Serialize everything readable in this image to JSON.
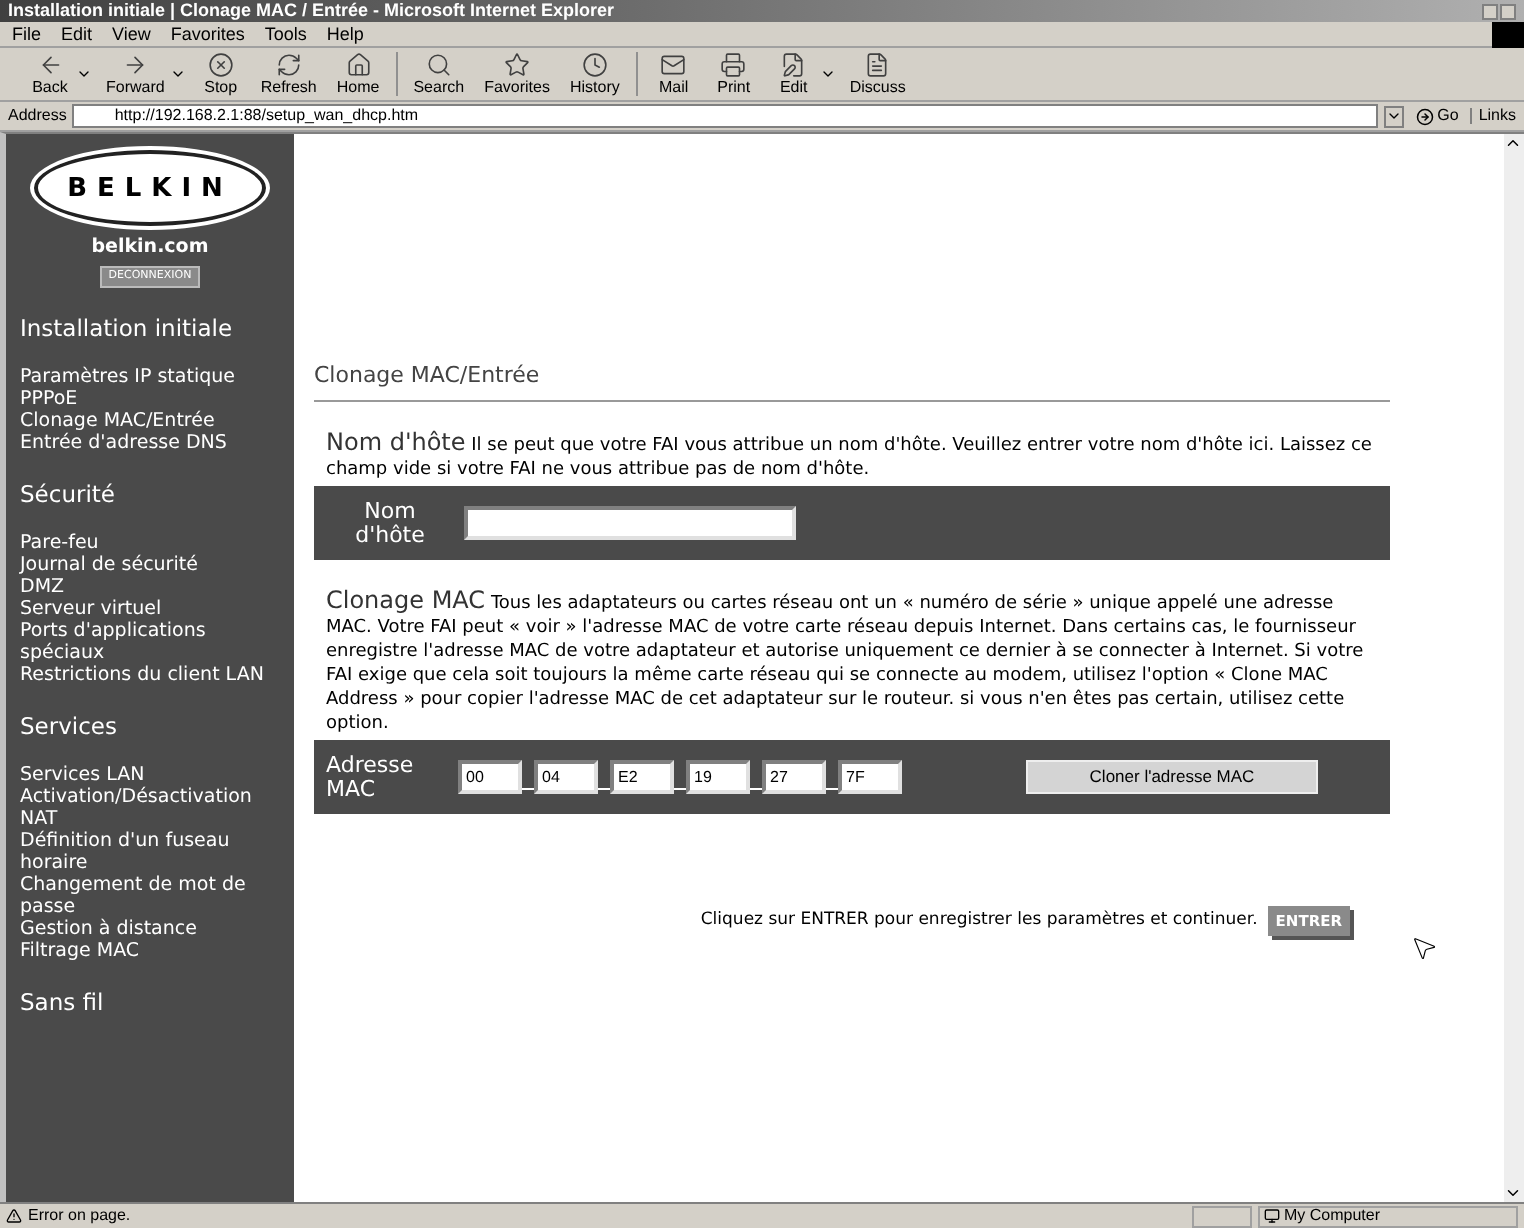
{
  "window": {
    "title": "Installation initiale | Clonage MAC / Entrée - Microsoft Internet Explorer"
  },
  "menu": [
    "File",
    "Edit",
    "View",
    "Favorites",
    "Tools",
    "Help"
  ],
  "toolbar": [
    {
      "label": "Back",
      "dropdown": true
    },
    {
      "label": "Forward",
      "dropdown": true
    },
    {
      "label": "Stop",
      "dropdown": false
    },
    {
      "label": "Refresh",
      "dropdown": false
    },
    {
      "label": "Home",
      "dropdown": false
    },
    {
      "label": "Search",
      "dropdown": false
    },
    {
      "label": "Favorites",
      "dropdown": false
    },
    {
      "label": "History",
      "dropdown": false
    },
    {
      "label": "Mail",
      "dropdown": false
    },
    {
      "label": "Print",
      "dropdown": false
    },
    {
      "label": "Edit",
      "dropdown": true
    },
    {
      "label": "Discuss",
      "dropdown": false
    }
  ],
  "address": {
    "label": "Address",
    "value": "http://192.168.2.1:88/setup_wan_dhcp.htm",
    "go": "Go",
    "links": "Links"
  },
  "sidebar": {
    "logo": "BELKIN",
    "site": "belkin.com",
    "logout": "DECONNEXION",
    "sections": [
      {
        "title": "Installation initiale",
        "items": [
          "Paramètres IP statique",
          "PPPoE",
          "Clonage MAC/Entrée",
          "Entrée d'adresse DNS"
        ]
      },
      {
        "title": "Sécurité",
        "items": [
          "Pare-feu",
          "Journal de sécurité",
          "DMZ",
          "Serveur virtuel",
          "Ports d'applications spéciaux",
          "Restrictions du client LAN"
        ]
      },
      {
        "title": "Services",
        "items": [
          "Services LAN",
          "Activation/Désactivation NAT",
          "Définition d'un fuseau horaire",
          "Changement de mot de passe",
          "Gestion à distance",
          "Filtrage MAC"
        ]
      },
      {
        "title": "Sans fil"
      }
    ]
  },
  "content": {
    "title": "Clonage MAC/Entrée",
    "hostname": {
      "heading": "Nom d'hôte",
      "text": "Il se peut que votre FAI vous attribue un nom d'hôte. Veuillez entrer votre nom d'hôte ici. Laissez ce champ vide si votre FAI ne vous attribue pas de nom d'hôte.",
      "label": "Nom d'hôte"
    },
    "mac": {
      "heading": "Clonage MAC",
      "text": "Tous les adaptateurs ou cartes réseau ont un « numéro de série » unique appelé une adresse MAC. Votre FAI peut « voir » l'adresse MAC de votre carte réseau depuis Internet. Dans certains cas, le fournisseur enregistre l'adresse MAC de votre adaptateur et autorise uniquement ce dernier à se connecter à Internet. Si votre FAI exige que cela soit toujours la même carte réseau qui se connecte au modem, utilisez l'option « Clone MAC Address » pour copier l'adresse MAC de cet adaptateur sur le routeur. si vous n'en êtes pas certain, utilisez cette option.",
      "label": "Adresse MAC",
      "octets": [
        "00",
        "04",
        "E2",
        "19",
        "27",
        "7F"
      ],
      "button": "Cloner l'adresse MAC"
    },
    "footer": {
      "text": "Cliquez sur ENTRER pour enregistrer les paramètres et continuer.",
      "button": "ENTRER"
    }
  },
  "status_bar": {
    "text": "Error on page.",
    "zone": "My Computer"
  }
}
